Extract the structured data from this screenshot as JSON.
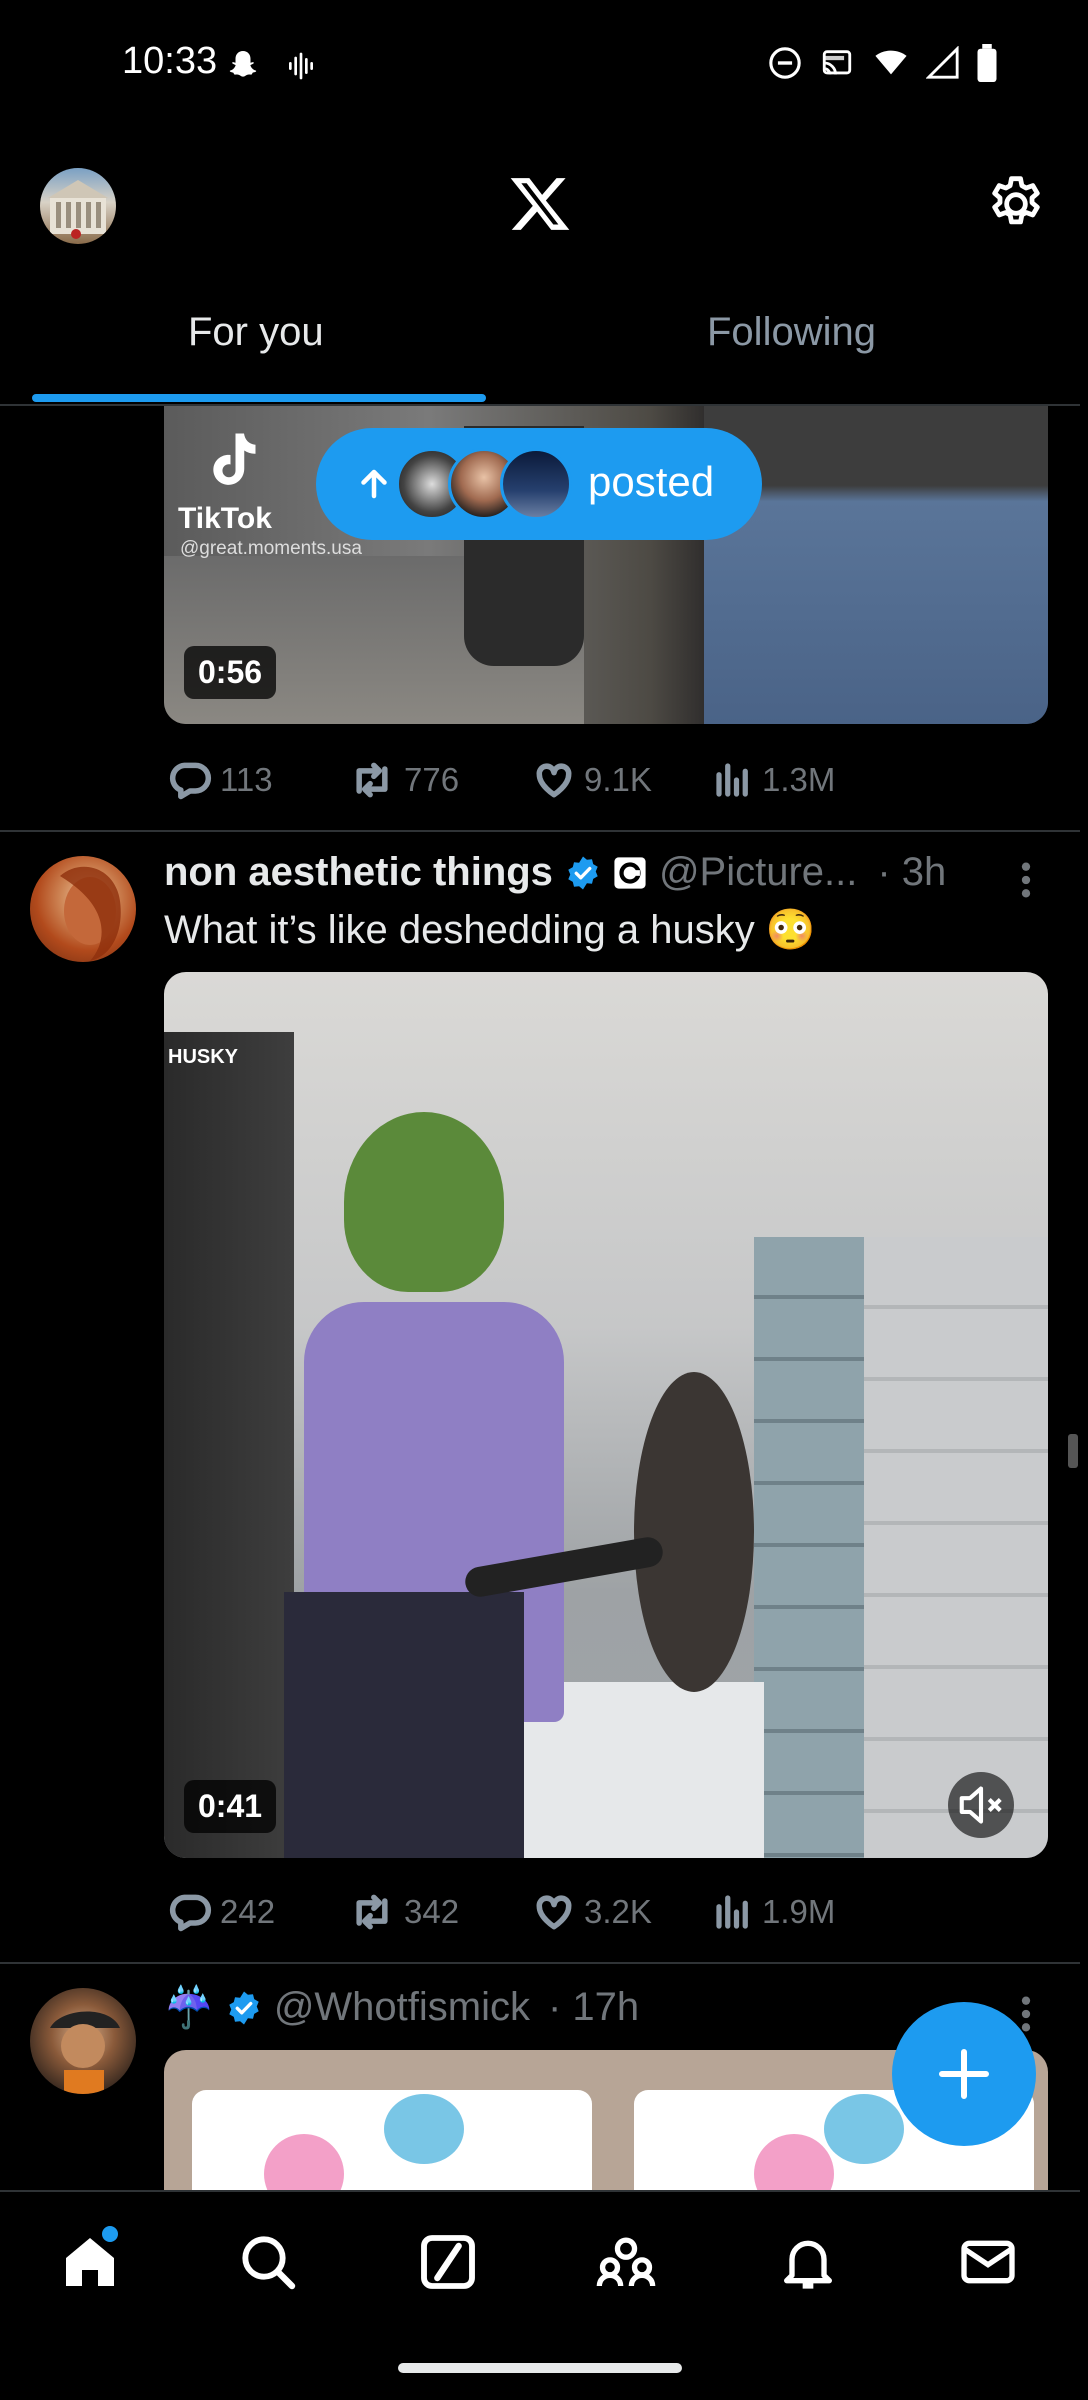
{
  "status_bar": {
    "time": "10:33",
    "left_icons": [
      "snapchat-icon",
      "voice-wave-icon"
    ],
    "right_icons": [
      "do-not-disturb-icon",
      "cast-icon",
      "wifi-icon",
      "signal-icon",
      "battery-icon"
    ]
  },
  "header": {
    "logo_icon": "x-logo-icon",
    "settings_icon": "gear-icon"
  },
  "tabs": [
    {
      "label": "For you",
      "active": true
    },
    {
      "label": "Following",
      "active": false
    }
  ],
  "accent_color": "#1d9bf0",
  "posted_pill": {
    "label": "posted",
    "icon": "arrow-up-icon"
  },
  "post1": {
    "media": {
      "watermark_brand": "TikTok",
      "watermark_handle": "@great.moments.usa",
      "duration": "0:56"
    },
    "actions": {
      "replies": "113",
      "reposts": "776",
      "likes": "9.1K",
      "views": "1.3M"
    }
  },
  "post2": {
    "name": "non aesthetic things",
    "handle": "@Picture...",
    "time": "· 3h",
    "text": "What it’s like deshedding a husky 😳",
    "media": {
      "overlay_label": "HUSKY",
      "duration": "0:41"
    },
    "actions": {
      "replies": "242",
      "reposts": "342",
      "likes": "3.2K",
      "views": "1.9M"
    }
  },
  "post3": {
    "name_emoji": "☔",
    "handle": "@Whotfismick",
    "time": "· 17h"
  },
  "fab_icon": "plus-icon",
  "bottom_nav": [
    "home-icon",
    "search-icon",
    "grok-icon",
    "communities-icon",
    "notifications-icon",
    "messages-icon"
  ]
}
